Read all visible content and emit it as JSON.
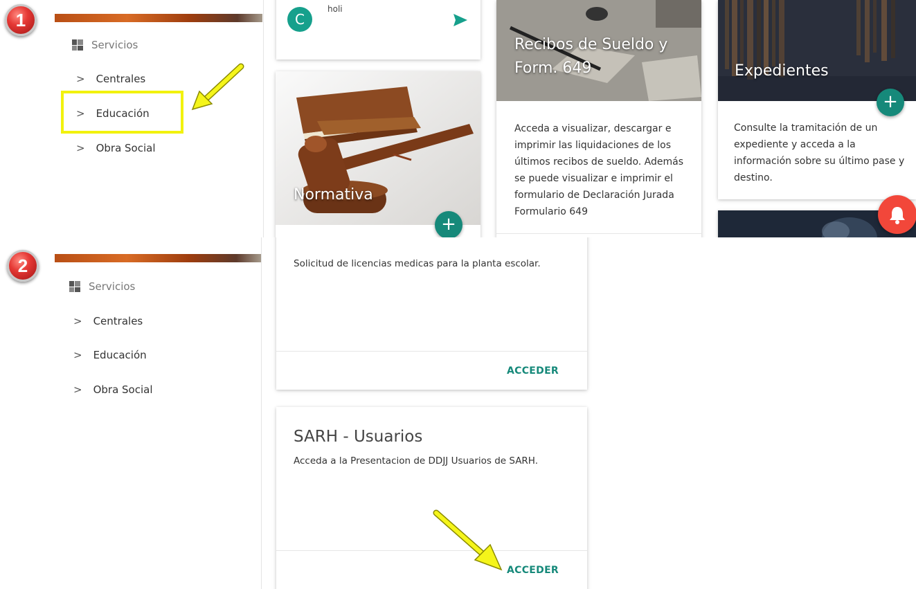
{
  "steps": {
    "step1": "1",
    "step2": "2"
  },
  "sidebar": {
    "header": "Servicios",
    "items": [
      {
        "label": "Centrales"
      },
      {
        "label": "Educación"
      },
      {
        "label": "Obra Social"
      }
    ]
  },
  "panel1": {
    "comment": {
      "avatar_initial": "C",
      "text": "holi"
    },
    "cards": [
      {
        "title": "Normativa"
      },
      {
        "title": "Recibos de Sueldo y Form. 649",
        "description": "Acceda a visualizar, descargar e imprimir las liquidaciones de los últimos recibos de sueldo. Además se puede visualizar e imprimir el formulario de Declaración Jurada Formulario 649"
      },
      {
        "title": "Expedientes",
        "description": "Consulte la tramitación de un expediente y acceda a la información sobre su último pase y destino."
      }
    ],
    "fab_plus": "+"
  },
  "panel2": {
    "cards": [
      {
        "description": "Solicitud de licencias medicas para la planta escolar.",
        "action": "ACCEDER"
      },
      {
        "title": "SARH - Usuarios",
        "description": "Acceda a la Presentacion de DDJJ Usuarios de SARH.",
        "action": "ACCEDER"
      }
    ]
  },
  "colors": {
    "accent": "#16897a",
    "alert": "#f2473a",
    "highlight": "#f2f20e"
  },
  "icons": [
    "grid-icon",
    "chevron-right-icon",
    "send-icon",
    "plus-icon",
    "bell-icon",
    "arrow-annotation"
  ]
}
